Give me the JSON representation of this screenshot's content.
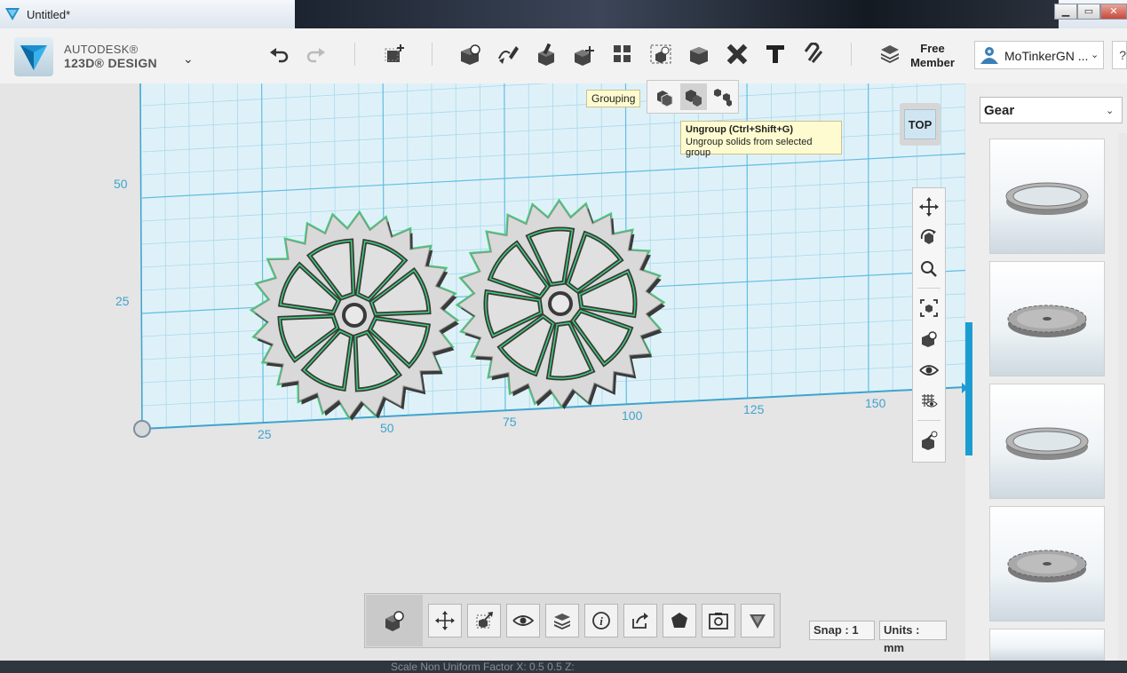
{
  "window": {
    "title": "Untitled*"
  },
  "brand": {
    "line1": "AUTODESK®",
    "line2": "123D® DESIGN"
  },
  "toolbar": {
    "tools": [
      {
        "name": "undo-icon"
      },
      {
        "name": "redo-icon"
      },
      {
        "name": "transform-icon"
      },
      {
        "name": "primitives-icon"
      },
      {
        "name": "sketch-icon"
      },
      {
        "name": "construct-icon"
      },
      {
        "name": "modify-icon"
      },
      {
        "name": "pattern-icon"
      },
      {
        "name": "grouping-icon"
      },
      {
        "name": "combine-icon"
      },
      {
        "name": "measure-icon"
      },
      {
        "name": "text-icon"
      },
      {
        "name": "snap-icon"
      }
    ],
    "member": {
      "line1": "Free",
      "line2": "Member"
    },
    "user": {
      "name": "MoTinkerGN ..."
    },
    "help_label": "?"
  },
  "grouping_flyout": {
    "tooltip": "Grouping",
    "ungroup_tooltip": {
      "title": "Ungroup (Ctrl+Shift+G)",
      "description": "Ungroup solids from selected group"
    }
  },
  "viewcube": {
    "face": "TOP"
  },
  "axis_labels": {
    "y": [
      "50",
      "25"
    ],
    "x": [
      "25",
      "50",
      "75",
      "100",
      "125",
      "150"
    ]
  },
  "status": {
    "snap": "Snap : 1",
    "units": "Units : mm"
  },
  "bottom_strip": {
    "text": "Scale   Non Uniform        Factor X:  0.5          0.5          Z:"
  },
  "side_panel": {
    "category": "Gear",
    "thumbnails": [
      "gear-ring-icon",
      "spur-gear-icon",
      "gear-ring-icon",
      "spur-gear-icon"
    ]
  }
}
